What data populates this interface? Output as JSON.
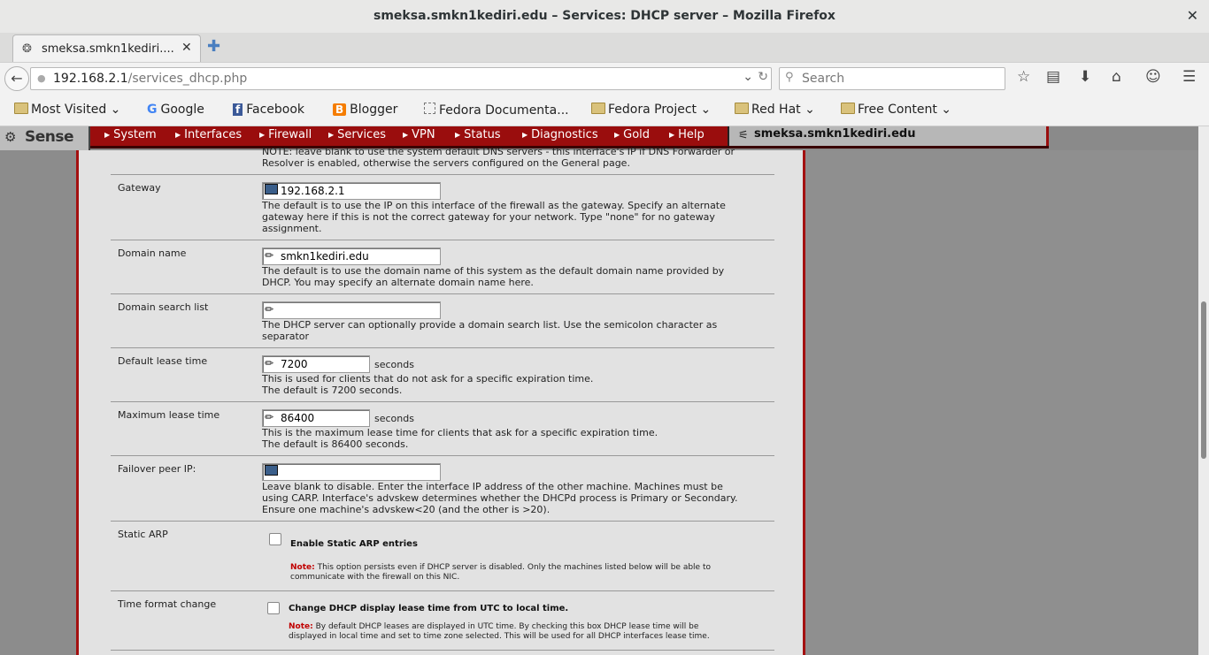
{
  "window": {
    "title": "smeksa.smkn1kediri.edu – Services: DHCP server – Mozilla Firefox",
    "close": "✕"
  },
  "tab": {
    "label": "smeksa.smkn1kediri....",
    "close": "✕",
    "new_tab": "✚"
  },
  "nav": {
    "back_icon": "back-arrow-icon",
    "url_host": "192.168.2.1",
    "url_path": "/services_dhcp.php",
    "search_placeholder": "Search"
  },
  "bookmarks": [
    "Most Visited",
    "Google",
    "Facebook",
    "Blogger",
    "Fedora Documenta...",
    "Fedora Project",
    "Red Hat",
    "Free Content"
  ],
  "menu": {
    "items": [
      "System",
      "Interfaces",
      "Firewall",
      "Services",
      "VPN",
      "Status",
      "Diagnostics",
      "Gold",
      "Help"
    ],
    "hostname": "smeksa.smkn1kediri.edu",
    "logo_text": "Sense"
  },
  "form": {
    "top_note": {
      "line1": "NOTE: leave blank to use the system default DNS servers - this interface's IP if DNS Forwarder or",
      "line2": "Resolver is enabled, otherwise the servers configured on the General page."
    },
    "gateway": {
      "label": "Gateway",
      "value": "192.168.2.1",
      "desc1": "The default is to use the IP on this interface of the firewall as the gateway. Specify an alternate",
      "desc2": "gateway here if this is not the correct gateway for your network. Type \"none\" for no gateway",
      "desc3": "assignment."
    },
    "domain_name": {
      "label": "Domain name",
      "value": "smkn1kediri.edu",
      "desc1": "The default is to use the domain name of this system as the default domain name provided by",
      "desc2": "DHCP. You may specify an alternate domain name here."
    },
    "domain_search": {
      "label": "Domain search list",
      "value": "",
      "desc1": "The DHCP server can optionally provide a domain search list. Use the semicolon character as",
      "desc2": "separator"
    },
    "default_lease": {
      "label": "Default lease time",
      "value": "7200",
      "unit": "seconds",
      "desc1": "This is used for clients that do not ask for a specific expiration time.",
      "desc2": "The default is 7200 seconds."
    },
    "max_lease": {
      "label": "Maximum lease time",
      "value": "86400",
      "unit": "seconds",
      "desc1": "This is the maximum lease time for clients that ask for a specific expiration time.",
      "desc2": "The default is 86400 seconds."
    },
    "failover": {
      "label": "Failover peer IP:",
      "value": "",
      "desc1": "Leave blank to disable. Enter the interface IP address of the other machine. Machines must be",
      "desc2": "using CARP. Interface's advskew determines whether the DHCPd process is Primary or Secondary.",
      "desc3": "Ensure one machine's advskew<20 (and the other is >20)."
    },
    "static_arp": {
      "label": "Static ARP",
      "checkbox_label": "Enable Static ARP entries",
      "checked": false,
      "note_label": "Note:",
      "note1": "This option persists even if DHCP server is disabled. Only the machines listed below will be able to",
      "note2": "communicate with the firewall on this NIC."
    },
    "time_format": {
      "label": "Time format change",
      "checkbox_label": "Change DHCP display lease time from UTC to local time.",
      "checked": false,
      "note_label": "Note:",
      "note1": "By default DHCP leases are displayed in UTC time. By checking this box DHCP lease time will be",
      "note2": "displayed in local time and set to time zone selected. This will be used for all DHCP interfaces lease time."
    }
  }
}
